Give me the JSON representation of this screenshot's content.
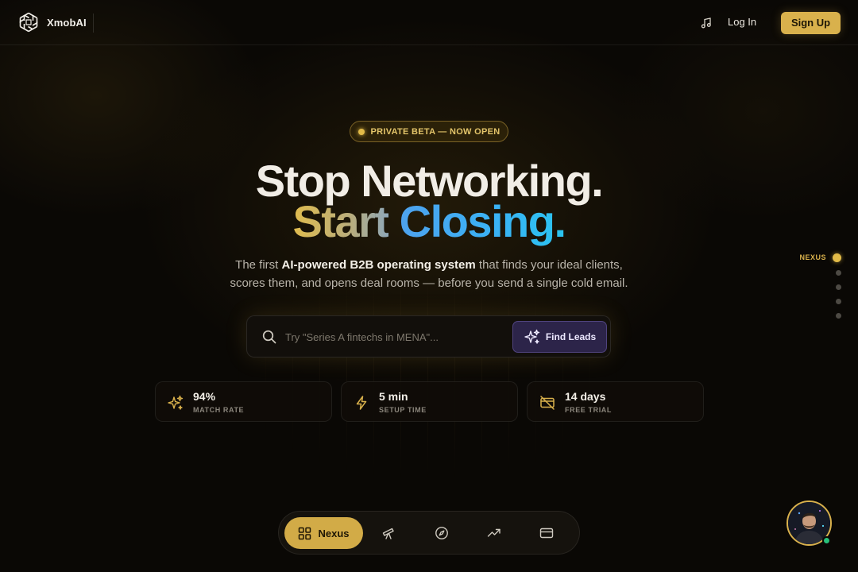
{
  "header": {
    "brand": "XmobAI",
    "login": "Log In",
    "signup": "Sign Up",
    "music_icon": "music-note-icon"
  },
  "hero": {
    "badge": "PRIVATE BETA — NOW OPEN",
    "headline_line1": "Stop Networking.",
    "headline_line2_a": "Start",
    "headline_line2_b": "Closing.",
    "subtitle_pre": "The first",
    "subtitle_bold": "AI-powered B2B operating system",
    "subtitle_post": "that finds your ideal clients,",
    "subtitle_line2": "scores them, and opens deal rooms — before you send a single cold email."
  },
  "search": {
    "placeholder": "Try \"Series A fintechs in MENA\"...",
    "value": "",
    "button_label": "Find Leads"
  },
  "stats": [
    {
      "value": "94%",
      "label": "MATCH RATE",
      "icon": "sparkles-icon"
    },
    {
      "value": "5 min",
      "label": "SETUP TIME",
      "icon": "lightning-icon"
    },
    {
      "value": "14 days",
      "label": "FREE TRIAL",
      "icon": "no-card-icon"
    }
  ],
  "side_nav": {
    "active_label": "NEXUS",
    "sections": 5,
    "active_index": 0
  },
  "dock": {
    "active_label": "Nexus",
    "items": [
      "grid-icon",
      "telescope-icon",
      "compass-icon",
      "trending-up-icon",
      "credit-card-icon"
    ]
  },
  "colors": {
    "accent_gold": "#d9b14c",
    "accent_blue": "#39b3f5",
    "button_purple": "#2c2449",
    "online_green": "#27c07a",
    "background": "#0b0905"
  }
}
